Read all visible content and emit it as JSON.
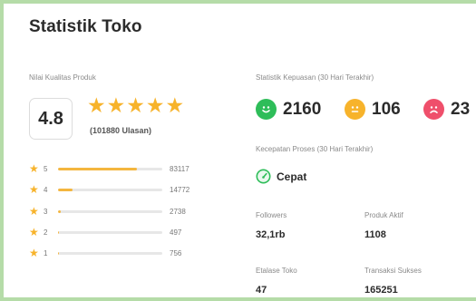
{
  "title": "Statistik Toko",
  "quality": {
    "label": "Nilai Kualitas Produk",
    "rating": "4.8",
    "reviews": "(101880 Ulasan)",
    "distribution": [
      {
        "star": "5",
        "count": "83117",
        "fraction": 0.7598
      },
      {
        "star": "4",
        "count": "14772",
        "fraction": 0.135
      },
      {
        "star": "3",
        "count": "2738",
        "fraction": 0.025
      },
      {
        "star": "2",
        "count": "497",
        "fraction": 0.0045
      },
      {
        "star": "1",
        "count": "756",
        "fraction": 0.0069
      }
    ]
  },
  "satisfaction": {
    "label": "Statistik Kepuasan (30 Hari Terakhir)",
    "items": [
      {
        "icon": "happy-face-icon",
        "value": "2160",
        "color": "#2ebd59"
      },
      {
        "icon": "neutral-face-icon",
        "value": "106",
        "color": "#f7b32b"
      },
      {
        "icon": "sad-face-icon",
        "value": "23",
        "color": "#ef4f6b"
      }
    ]
  },
  "speed": {
    "label": "Kecepatan Proses (30 Hari Terakhir)",
    "value": "Cepat",
    "icon": "speedometer-icon",
    "color": "#2ebd59"
  },
  "stats": {
    "followers_label": "Followers",
    "followers": "32,1rb",
    "produk_label": "Produk Aktif",
    "produk": "1108",
    "etalase_label": "Etalase Toko",
    "etalase": "47",
    "transaksi_label": "Transaksi Sukses",
    "transaksi": "165251"
  }
}
